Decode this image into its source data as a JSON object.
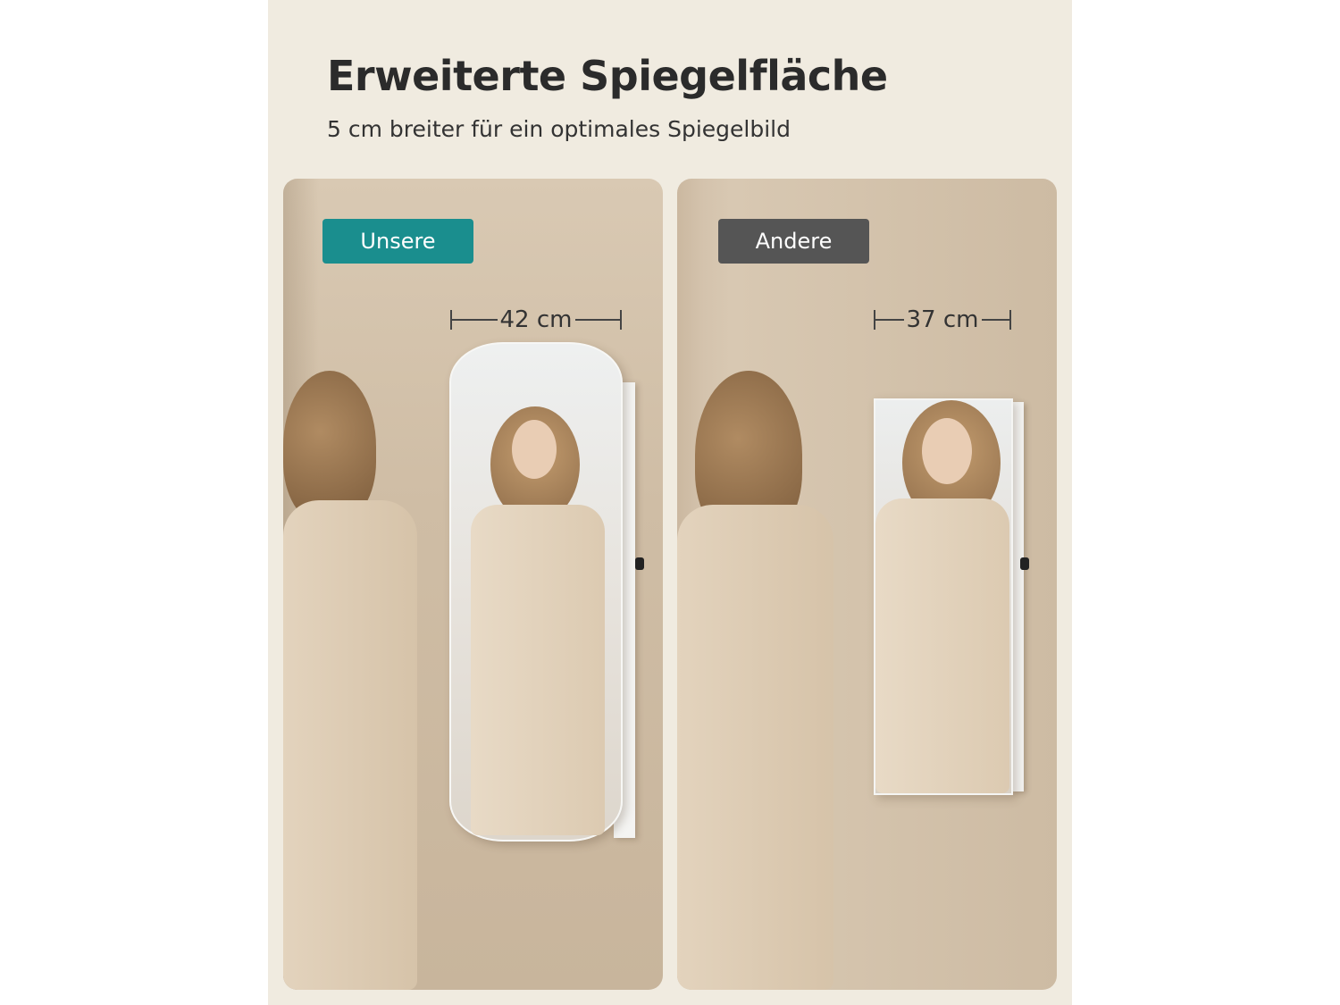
{
  "header": {
    "title": "Erweiterte Spiegelfläche",
    "subtitle": "5 cm breiter für ein optimales Spiegelbild"
  },
  "comparison": {
    "ours": {
      "badge": "Unsere",
      "width_label": "42 cm",
      "color": "#1a8e8e"
    },
    "other": {
      "badge": "Andere",
      "width_label": "37 cm",
      "color": "#555555"
    }
  }
}
